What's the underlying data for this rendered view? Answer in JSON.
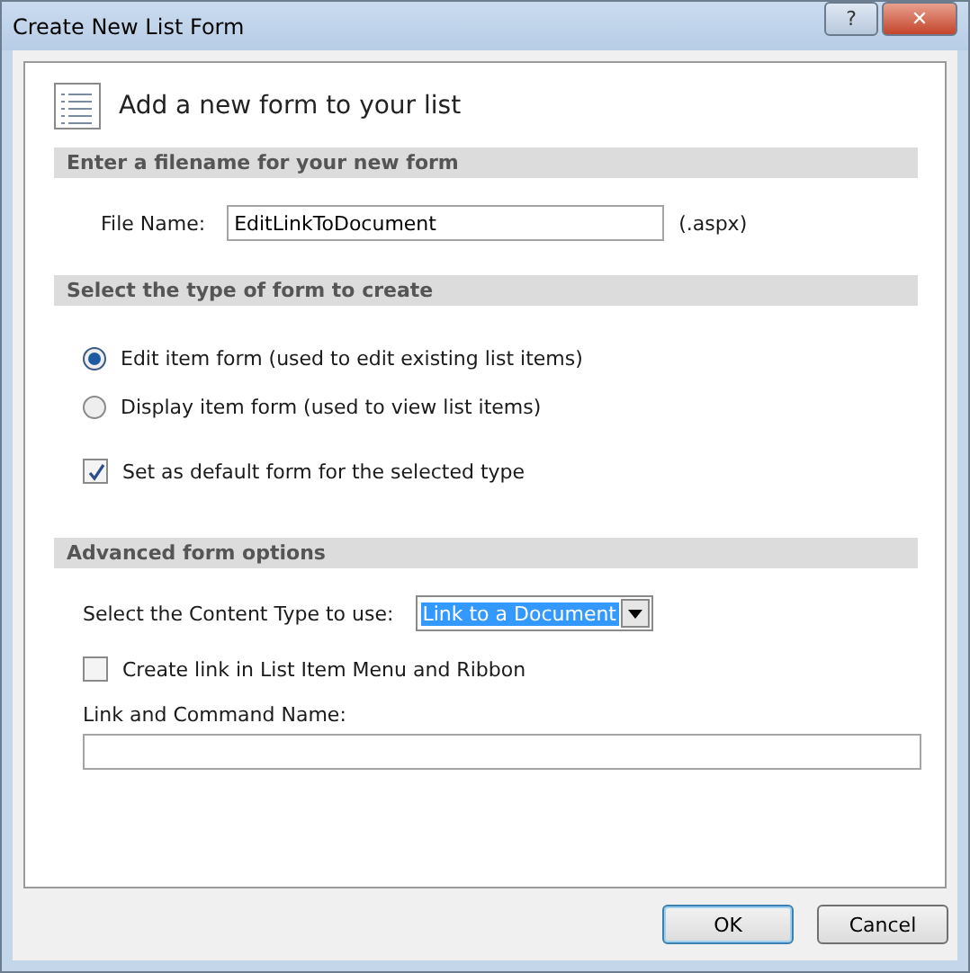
{
  "window": {
    "title": "Create New List Form",
    "help": "?",
    "close": "✕"
  },
  "heading": "Add a new form to your list",
  "filename_section": {
    "title": "Enter a filename for your new form",
    "label": "File Name:",
    "value": "EditLinkToDocument",
    "suffix": "(.aspx)"
  },
  "type_section": {
    "title": "Select the type of form to create",
    "options": [
      {
        "label": "Edit item form (used to edit existing list items)",
        "selected": true
      },
      {
        "label": "Display item form (used to view list items)",
        "selected": false
      }
    ],
    "default_checkbox": {
      "label": "Set as default form for the selected type",
      "checked": true
    }
  },
  "advanced_section": {
    "title": "Advanced form options",
    "content_type": {
      "label": "Select the Content Type to use:",
      "value": "Link to a Document"
    },
    "menu_checkbox": {
      "label": "Create link in List Item Menu and Ribbon",
      "checked": false
    },
    "command_name": {
      "label": "Link and Command Name:"
    }
  },
  "buttons": [
    {
      "label": "OK",
      "default": true
    },
    {
      "label": "Cancel",
      "default": false
    }
  ]
}
